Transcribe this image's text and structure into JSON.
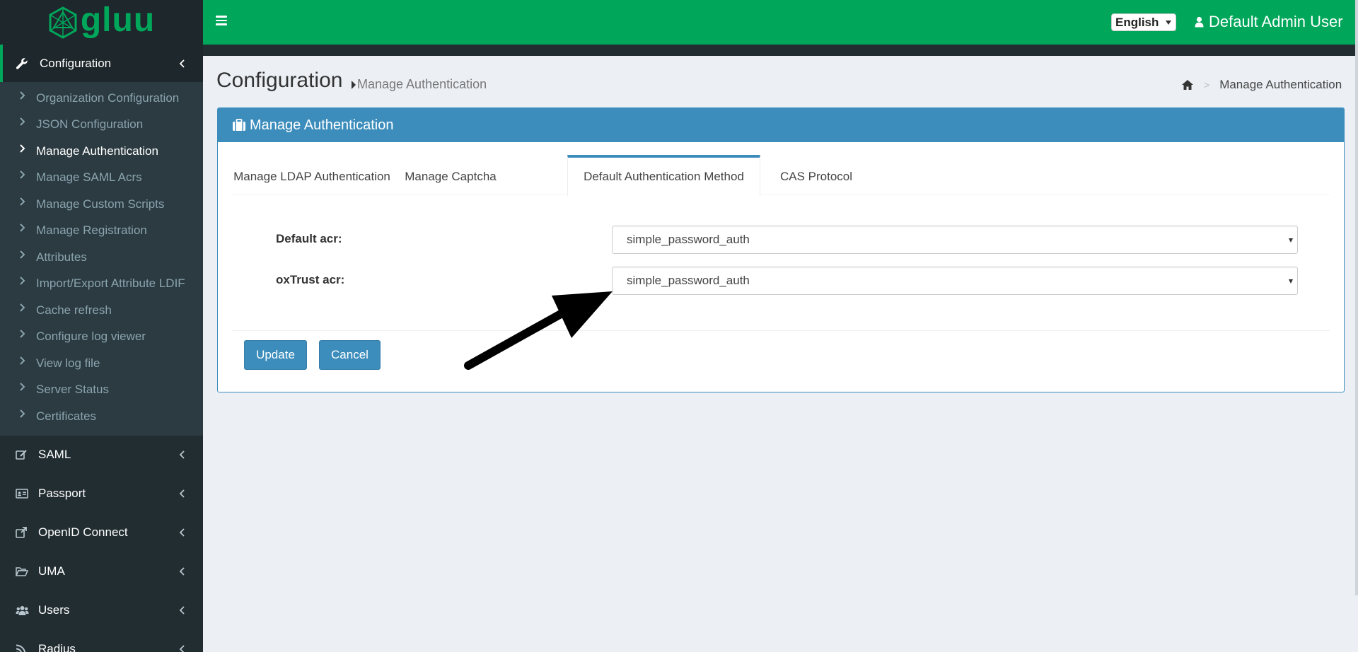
{
  "app": {
    "logo_text": "gluu"
  },
  "header": {
    "language": "English",
    "user_name": "Default Admin User"
  },
  "sidebar": {
    "open_section": "Configuration",
    "sub_items": [
      {
        "label": "Organization Configuration",
        "active": false
      },
      {
        "label": "JSON Configuration",
        "active": false
      },
      {
        "label": "Manage Authentication",
        "active": true
      },
      {
        "label": "Manage SAML Acrs",
        "active": false
      },
      {
        "label": "Manage Custom Scripts",
        "active": false
      },
      {
        "label": "Manage Registration",
        "active": false
      },
      {
        "label": "Attributes",
        "active": false
      },
      {
        "label": "Import/Export Attribute LDIF",
        "active": false
      },
      {
        "label": "Cache refresh",
        "active": false
      },
      {
        "label": "Configure log viewer",
        "active": false
      },
      {
        "label": "View log file",
        "active": false
      },
      {
        "label": "Server Status",
        "active": false
      },
      {
        "label": "Certificates",
        "active": false
      }
    ],
    "sections": [
      {
        "label": "SAML",
        "icon": "edit-icon"
      },
      {
        "label": "Passport",
        "icon": "id-card-icon"
      },
      {
        "label": "OpenID Connect",
        "icon": "external-link-icon"
      },
      {
        "label": "UMA",
        "icon": "folder-open-icon"
      },
      {
        "label": "Users",
        "icon": "users-icon"
      },
      {
        "label": "Radius",
        "icon": "rss-icon"
      }
    ]
  },
  "page": {
    "title": "Configuration",
    "subtitle": "Manage Authentication",
    "breadcrumb_current": "Manage Authentication"
  },
  "box": {
    "title": "Manage Authentication",
    "tabs": [
      {
        "label": "Manage LDAP Authentication",
        "active": false
      },
      {
        "label": "Manage Captcha",
        "active": false
      },
      {
        "label": "Default Authentication Method",
        "active": true
      },
      {
        "label": "CAS Protocol",
        "active": false
      }
    ],
    "fields": {
      "default_acr": {
        "label": "Default acr:",
        "value": "simple_password_auth"
      },
      "oxtrust_acr": {
        "label": "oxTrust acr:",
        "value": "simple_password_auth"
      }
    },
    "buttons": {
      "update": "Update",
      "cancel": "Cancel"
    }
  },
  "colors": {
    "header_green": "#00a65a",
    "sidebar_dark": "#222d32",
    "primary_blue": "#3c8dbc",
    "page_bg": "#ecf0f5"
  }
}
